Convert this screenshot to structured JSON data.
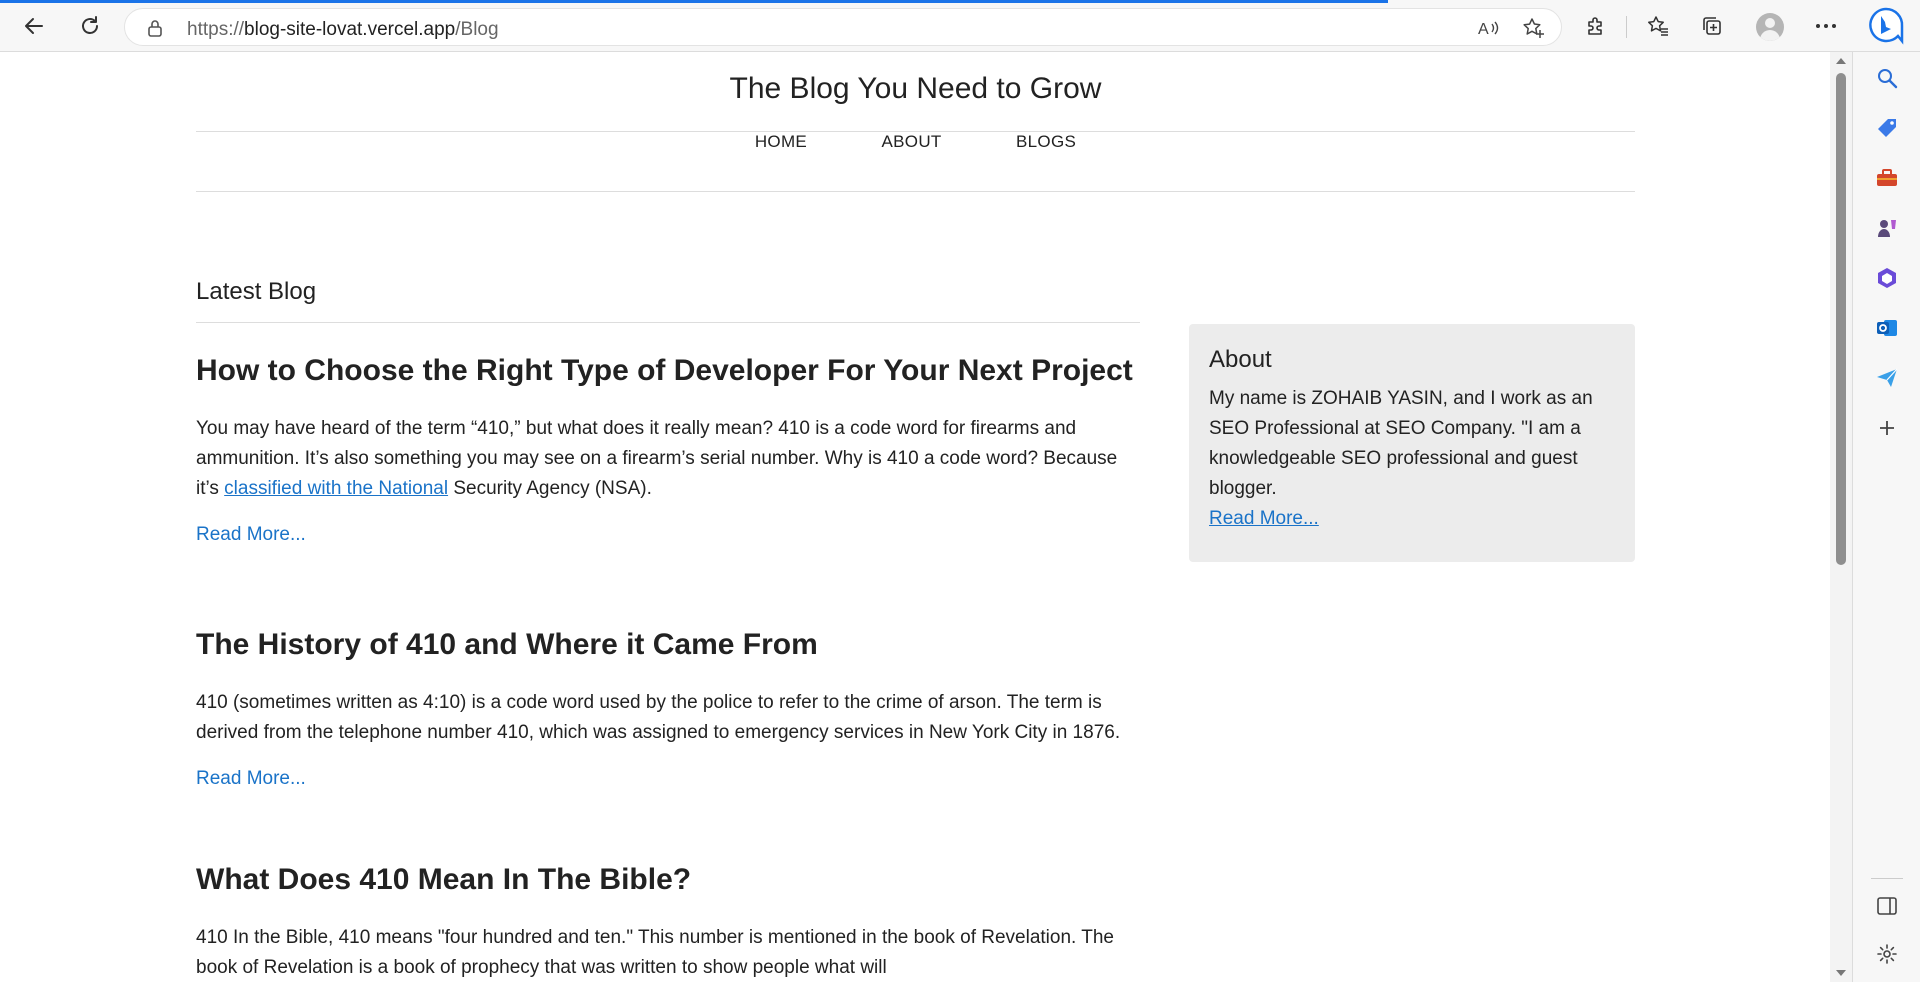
{
  "browser": {
    "url_prefix": "https://",
    "url_host": "blog-site-lovat.vercel.app",
    "url_path": "/Blog"
  },
  "site": {
    "title": "The Blog You Need to Grow",
    "nav": [
      "HOME",
      "ABOUT",
      "BLOGS"
    ]
  },
  "main": {
    "section_title": "Latest Blog",
    "posts": [
      {
        "title": "How to Choose the Right Type of Developer For Your Next Project",
        "body_before": "You may have heard of the term “410,” but what does it really mean? 410 is a code word for firearms and ammunition. It’s also something you may see on a firearm’s serial number. Why is 410 a code word? Because it’s ",
        "body_link": "classified with the National",
        "body_after": " Security Agency (NSA).",
        "read_more": "Read More..."
      },
      {
        "title": "The History of 410 and Where it Came From",
        "body": "410 (sometimes written as 4:10) is a code word used by the police to refer to the crime of arson. The term is derived from the telephone number 410, which was assigned to emergency services in New York City in 1876.",
        "read_more": "Read More..."
      },
      {
        "title": "What Does 410 Mean In The Bible?",
        "body": "410 In the Bible, 410 means \"four hundred and ten.\" This number is mentioned in the book of Revelation. The book of Revelation is a book of prophecy that was written to show people what will"
      }
    ]
  },
  "about": {
    "title": "About",
    "body": "My name is ZOHAIB YASIN, and I work as an SEO Professional at SEO Company. \"I am a knowledgeable SEO professional and guest blogger.",
    "read_more": "Read More..."
  },
  "icons": {
    "toolbar": [
      "back-arrow-icon",
      "refresh-icon",
      "lock-icon",
      "read-aloud-icon",
      "add-favorite-icon",
      "extensions-icon",
      "favorites-icon",
      "collections-icon",
      "profile-avatar",
      "more-icon",
      "bing-copilot-icon"
    ],
    "sidebar": [
      "search-icon",
      "shopping-tag-icon",
      "tools-briefcase-icon",
      "games-icon",
      "office-icon",
      "outlook-icon",
      "send-drop-icon",
      "add-icon",
      "sidebar-toggle-icon",
      "settings-icon"
    ]
  },
  "colors": {
    "link": "#1a73c8",
    "progress": "#1a73e8",
    "about_bg": "#ececec"
  }
}
